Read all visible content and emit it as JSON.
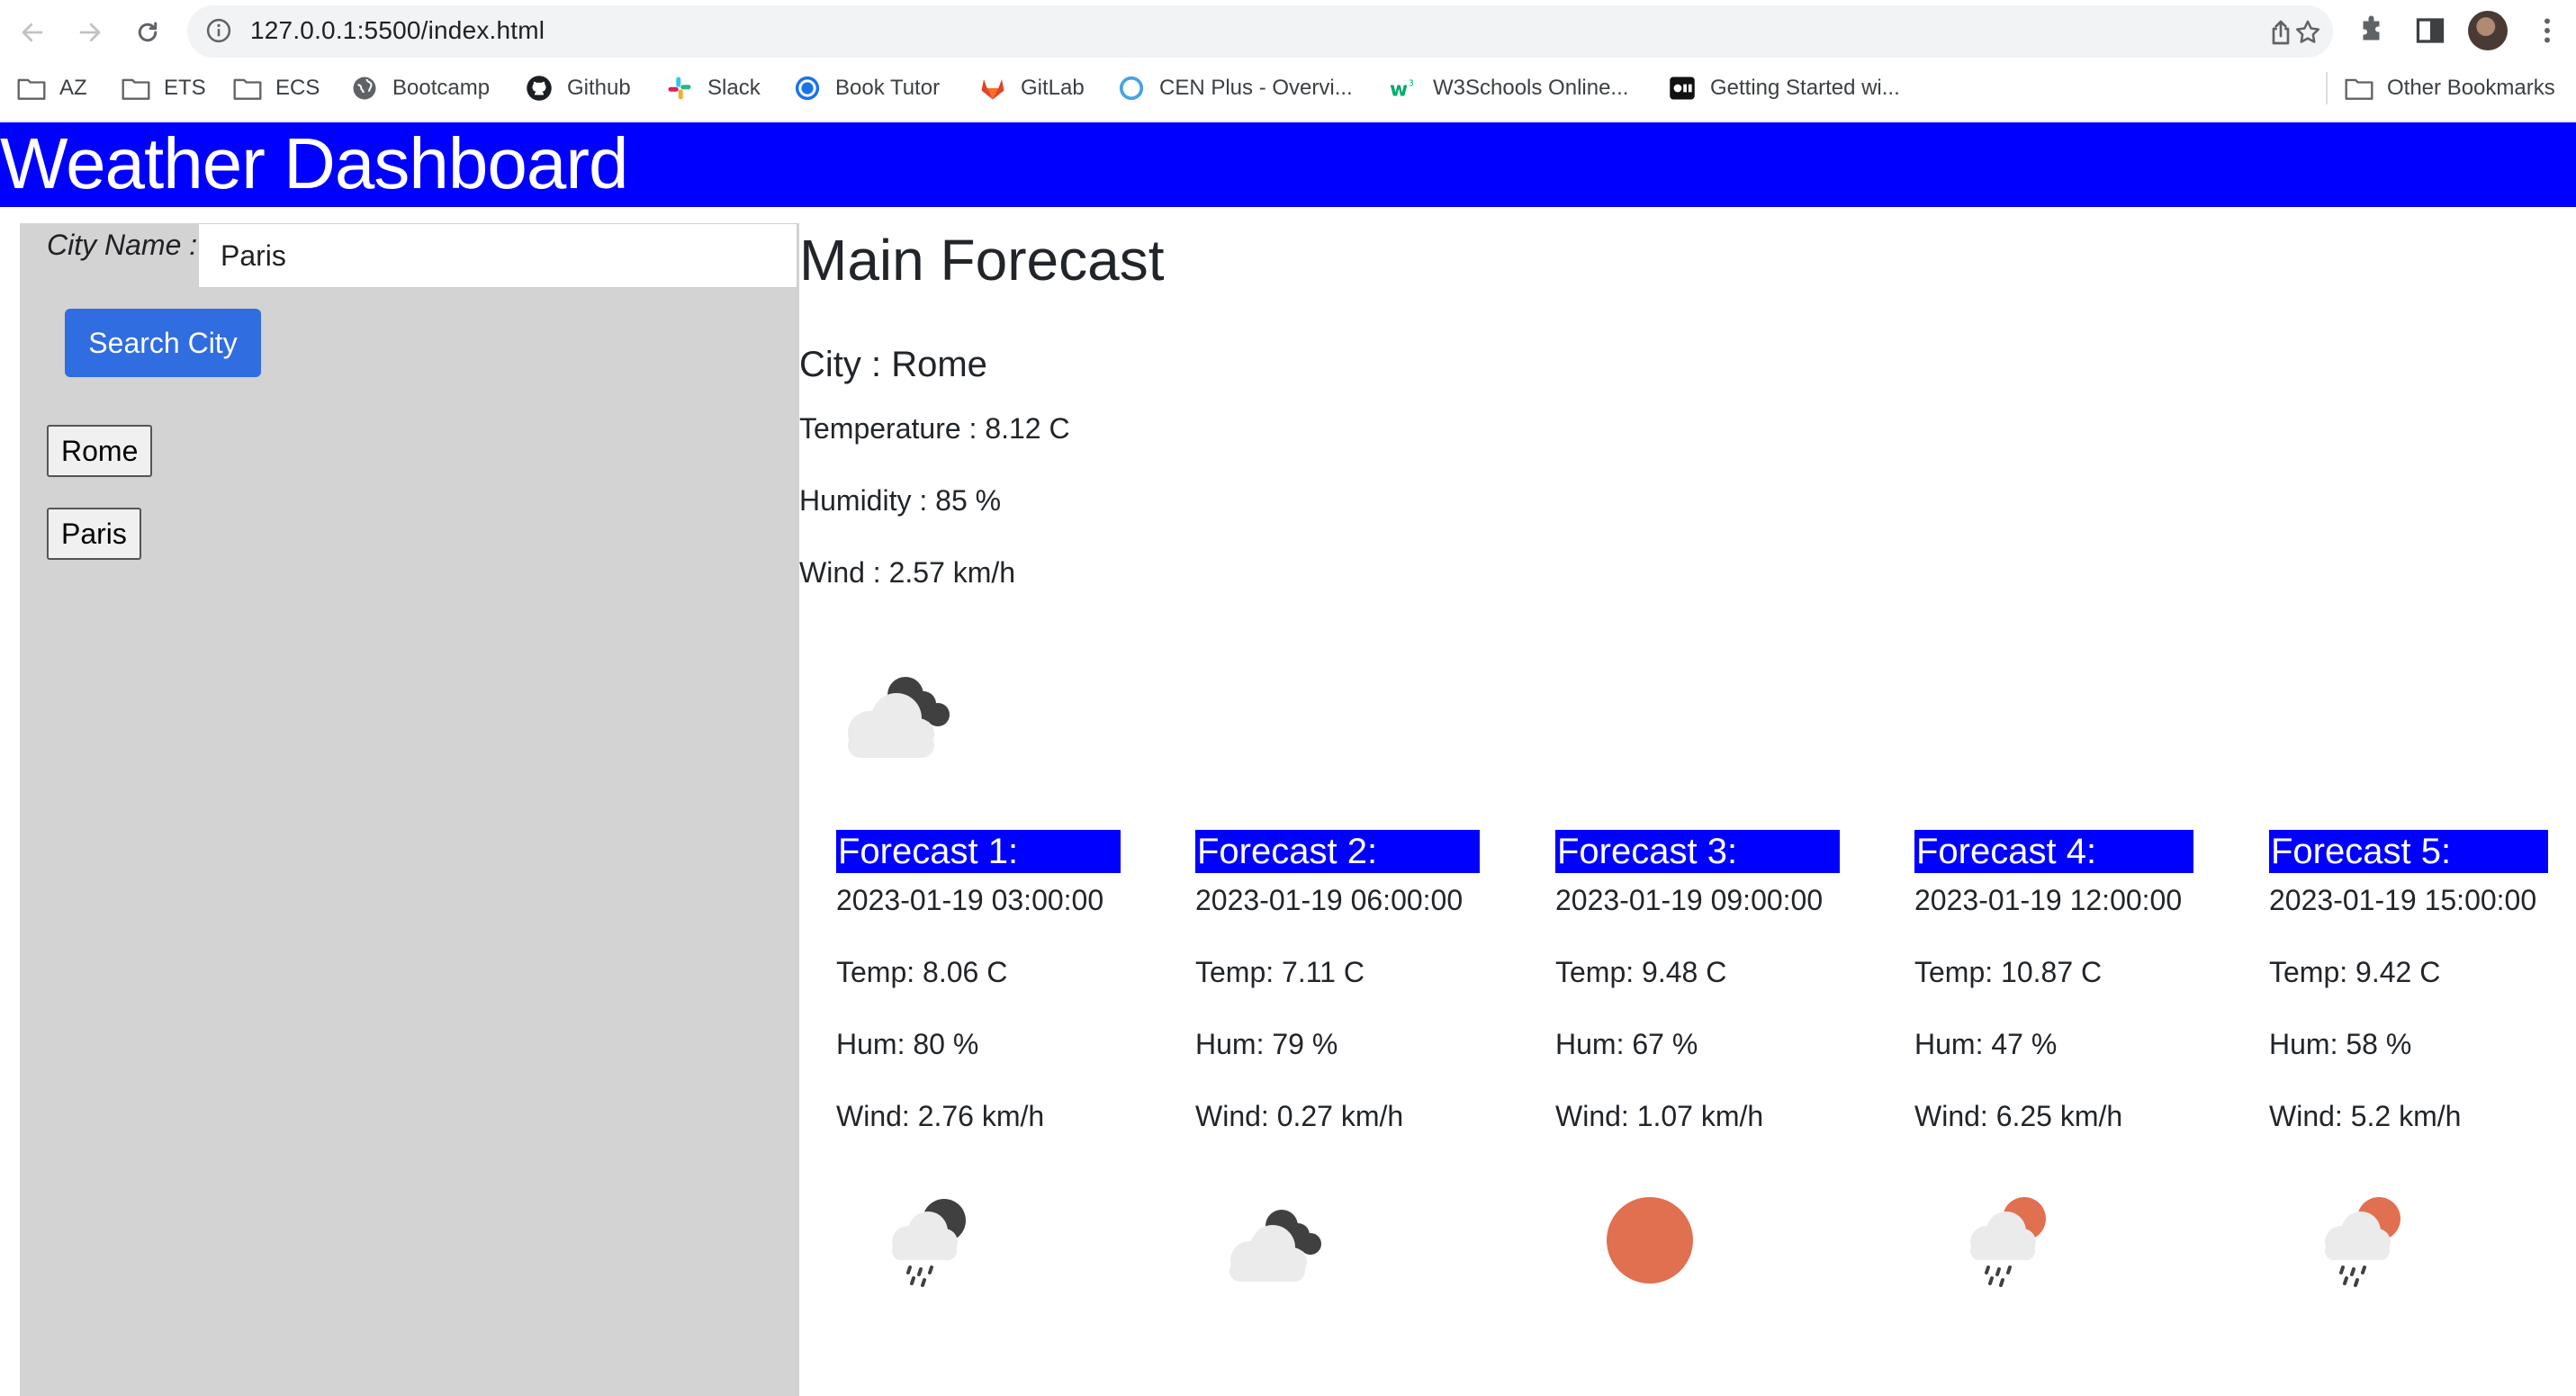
{
  "browser": {
    "url": "127.0.0.1:5500/index.html",
    "bookmarks": [
      {
        "label": "AZ",
        "icon": "folder-icon"
      },
      {
        "label": "ETS",
        "icon": "folder-icon"
      },
      {
        "label": "ECS",
        "icon": "folder-icon"
      },
      {
        "label": "Bootcamp",
        "icon": "globe-icon"
      },
      {
        "label": "Github",
        "icon": "github-icon"
      },
      {
        "label": "Slack",
        "icon": "slack-icon"
      },
      {
        "label": "Book Tutor",
        "icon": "book-tutor-icon"
      },
      {
        "label": "GitLab",
        "icon": "gitlab-icon"
      },
      {
        "label": "CEN Plus - Overvi...",
        "icon": "cen-icon"
      },
      {
        "label": "W3Schools Online...",
        "icon": "w3schools-icon"
      },
      {
        "label": "Getting Started wi...",
        "icon": "video-icon"
      }
    ],
    "other_bookmarks": "Other Bookmarks"
  },
  "header": {
    "title": "Weather Dashboard"
  },
  "sidebar": {
    "city_label": "City Name :",
    "city_input_value": "Paris",
    "search_button": "Search City",
    "history": [
      "Rome",
      "Paris"
    ]
  },
  "main": {
    "heading": "Main Forecast",
    "city": "City : Rome",
    "temperature": "Temperature : 8.12 C",
    "humidity": "Humidity : 85 %",
    "wind": "Wind : 2.57 km/h",
    "icon": "broken-clouds-icon"
  },
  "forecasts": [
    {
      "title": "Forecast 1:",
      "date": "2023-01-19 03:00:00",
      "temp": "Temp: 8.06 C",
      "hum": "Hum: 80 %",
      "wind": "Wind: 2.76 km/h",
      "icon": "rain-night-icon"
    },
    {
      "title": "Forecast 2:",
      "date": "2023-01-19 06:00:00",
      "temp": "Temp: 7.11 C",
      "hum": "Hum: 79 %",
      "wind": "Wind: 0.27 km/h",
      "icon": "broken-clouds-icon"
    },
    {
      "title": "Forecast 3:",
      "date": "2023-01-19 09:00:00",
      "temp": "Temp: 9.48 C",
      "hum": "Hum: 67 %",
      "wind": "Wind: 1.07 km/h",
      "icon": "clear-sun-icon"
    },
    {
      "title": "Forecast 4:",
      "date": "2023-01-19 12:00:00",
      "temp": "Temp: 10.87 C",
      "hum": "Hum: 47 %",
      "wind": "Wind: 6.25 km/h",
      "icon": "rain-day-icon"
    },
    {
      "title": "Forecast 5:",
      "date": "2023-01-19 15:00:00",
      "temp": "Temp: 9.42 C",
      "hum": "Hum: 58 %",
      "wind": "Wind: 5.2 km/h",
      "icon": "rain-day-icon"
    }
  ],
  "colors": {
    "header_bg": "#0000ff",
    "sidebar_bg": "#d3d3d3",
    "search_button_bg": "#2f6de0",
    "sun": "#e07050"
  }
}
